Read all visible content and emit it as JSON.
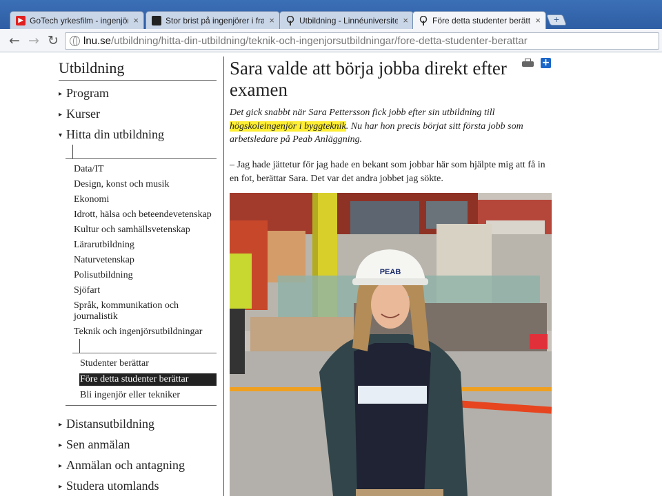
{
  "browser": {
    "tabs": [
      {
        "title": "GoTech yrkesfilm - ingenjör",
        "favicon": "youtube-icon",
        "active": false
      },
      {
        "title": "Stor brist på ingenjörer i fra",
        "favicon": "site-icon",
        "active": false
      },
      {
        "title": "Utbildning - Linnéuniversite",
        "favicon": "lnu-tree-icon",
        "active": false
      },
      {
        "title": "Före detta studenter berätta",
        "favicon": "lnu-tree-icon",
        "active": true
      }
    ],
    "url_host": "lnu.se",
    "url_path": "/utbildning/hitta-din-utbildning/teknik-och-ingenjorsutbildningar/fore-detta-studenter-berattar",
    "close_glyph": "×",
    "new_tab_glyph": "+",
    "back_glyph": "←",
    "forward_glyph": "→",
    "reload_glyph": "↻"
  },
  "sidebar": {
    "title": "Utbildning",
    "arrow_closed": "▸",
    "arrow_open": "▾",
    "top_items": [
      "Program",
      "Kurser"
    ],
    "open_item": "Hitta din utbildning",
    "subcategories": [
      "Data/IT",
      "Design, konst och musik",
      "Ekonomi",
      "Idrott, hälsa och beteendevetenskap",
      "Kultur och samhällsvetenskap",
      "Lärarutbildning",
      "Naturvetenskap",
      "Polisutbildning",
      "Sjöfart",
      "Språk, kommunikation och journalistik",
      "Teknik och ingenjörsutbildningar"
    ],
    "subsubcategories": [
      {
        "label": "Studenter berättar",
        "selected": false
      },
      {
        "label": "Före detta studenter berättar",
        "selected": true
      },
      {
        "label": "Bli ingenjör eller tekniker",
        "selected": false
      }
    ],
    "bottom_items": [
      "Distansutbildning",
      "Sen anmälan",
      "Anmälan och antagning",
      "Studera utomlands"
    ]
  },
  "article": {
    "title": "Sara valde att börja jobba direkt efter examen",
    "ingress_before": "Det gick snabbt när Sara Pettersson fick jobb efter sin utbildning till ",
    "ingress_highlight": "högskoleingenjör i byggteknik",
    "ingress_after": ". Nu har hon precis börjat sitt första jobb som arbetsledare på Peab Anläggning.",
    "quote": "– Jag hade jättetur för jag hade en bekant som jobbar här som hjälpte mig att få in en fot, berättar Sara. Det var det andra jobbet jag sökte.",
    "share_glyph": "+",
    "photo_helmet_text": "PEAB"
  },
  "colors": {
    "highlight": "#ffee33",
    "selected_nav": "#222222",
    "share": "#1b66c9"
  }
}
